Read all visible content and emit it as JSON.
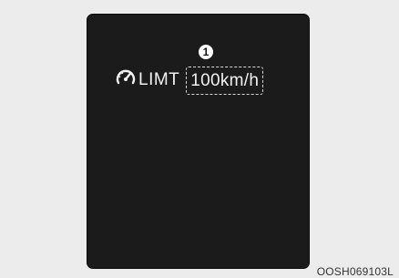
{
  "display": {
    "limit_label": "LIMT",
    "limit_value": "100km/h",
    "callout_number": "1",
    "icon": "speedometer-icon"
  },
  "figure_code": "OOSH069103L",
  "colors": {
    "background": "#ececec",
    "screen": "#1b1b1b",
    "text": "#f2f2f2",
    "dashed_border": "#d8d8d8"
  }
}
